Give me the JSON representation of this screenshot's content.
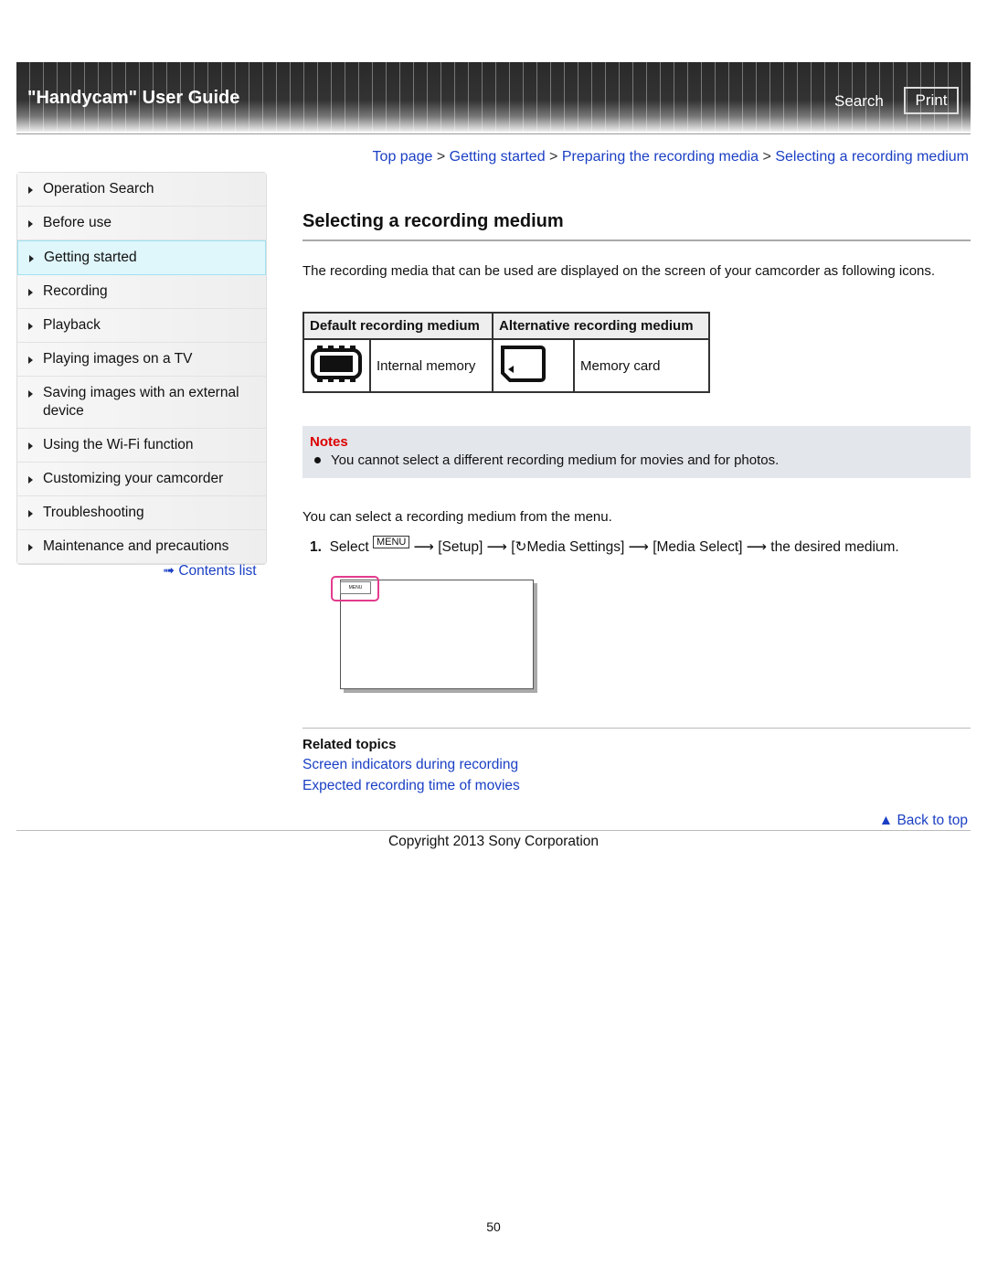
{
  "header": {
    "title": "\"Handycam\" User Guide",
    "search": "Search",
    "print": "Print"
  },
  "breadcrumb": [
    "Top page",
    "Getting started",
    "Preparing the recording media",
    "Selecting a recording medium"
  ],
  "sidebar": {
    "items": [
      "Operation Search",
      "Before use",
      "Getting started",
      "Recording",
      "Playback",
      "Playing images on a TV",
      "Saving images with an external device",
      "Using the Wi-Fi function",
      "Customizing your camcorder",
      "Troubleshooting",
      "Maintenance and precautions"
    ],
    "active": 2,
    "contents_link": "Contents list"
  },
  "main": {
    "title": "Selecting a recording medium",
    "intro": "The recording media that can be used are displayed on the screen of your camcorder as following icons.",
    "table": {
      "headers": [
        "Default recording medium",
        "Alternative recording medium"
      ],
      "default_label": "Internal memory",
      "alt_label": "Memory card",
      "default_icon": "internal-memory-icon",
      "alt_icon": "memory-card-icon"
    },
    "notes": {
      "heading": "Notes",
      "items": [
        "You cannot select a different recording medium for movies and for photos."
      ]
    },
    "menu_text": "You can select a recording medium from the menu.",
    "step": {
      "num": "1.",
      "select": "Select",
      "menu": "MENU",
      "setup": "[Setup]",
      "media_open": "[",
      "media_settings": "Media Settings]",
      "media_select": "[Media Select]",
      "end": "the desired medium."
    },
    "screen_menu": "MENU",
    "related": {
      "heading": "Related topics",
      "links": [
        "Screen indicators during recording",
        "Expected recording time of movies"
      ]
    },
    "back_to_top": "Back to top"
  },
  "footer": {
    "copyright": "Copyright 2013 Sony Corporation",
    "page": "50"
  },
  "colors": {
    "link": "#1a3fc4",
    "notes_heading": "#dd0000",
    "highlight": "#e33b8d"
  }
}
